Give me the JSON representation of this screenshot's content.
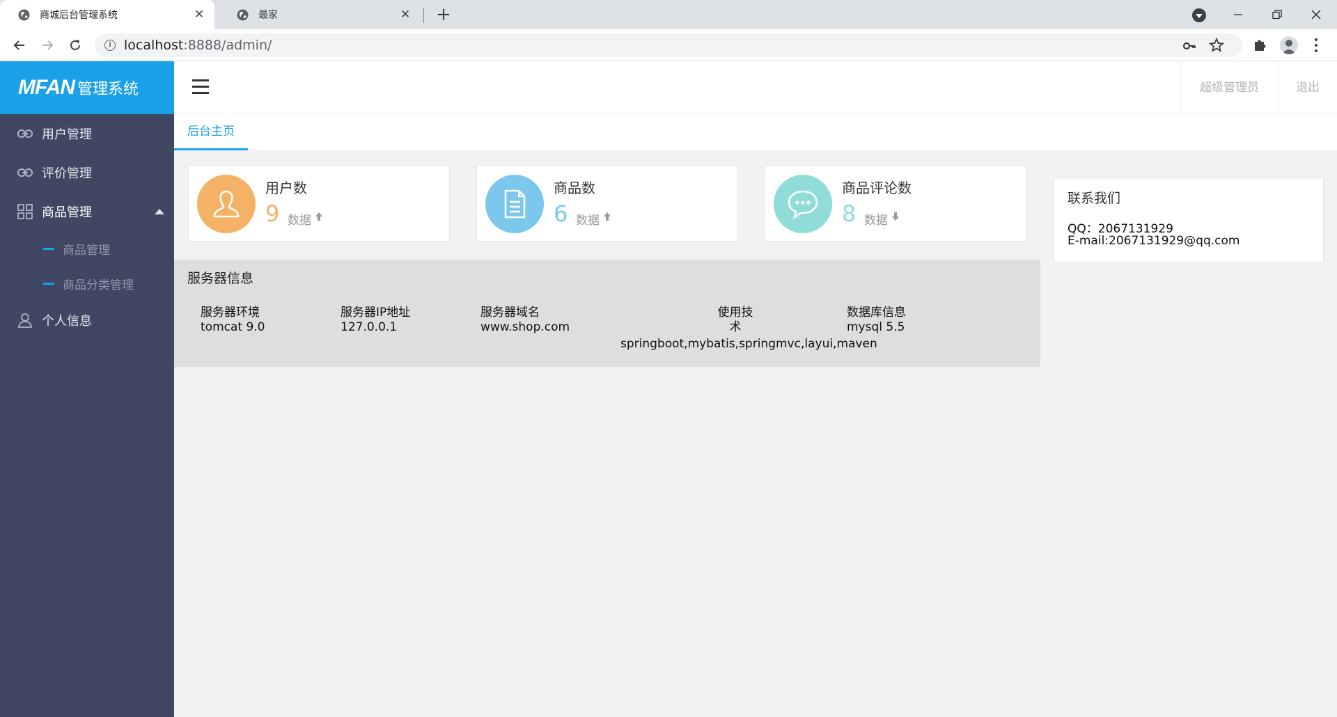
{
  "browser": {
    "tabs": [
      {
        "title": "商城后台管理系统",
        "close": "✕"
      },
      {
        "title": "最家",
        "close": "✕"
      }
    ],
    "new_tab": "+",
    "url_host": "localhost",
    "url_path": ":8888/admin/",
    "info_glyph": "i"
  },
  "app": {
    "logo": {
      "brand": "MFAN",
      "suffix": "管理系统"
    },
    "sidebar": {
      "items": [
        {
          "label": "用户管理",
          "icon": "link-icon"
        },
        {
          "label": "评价管理",
          "icon": "link-icon"
        },
        {
          "label": "商品管理",
          "icon": "grid-icon",
          "expanded": true,
          "children": [
            {
              "label": "商品管理"
            },
            {
              "label": "商品分类管理"
            }
          ]
        },
        {
          "label": "个人信息",
          "icon": "user-icon"
        }
      ]
    },
    "header": {
      "user": "超级管理员",
      "logout": "退出"
    },
    "tabs": {
      "home": "后台主页"
    },
    "stats": [
      {
        "title": "用户数",
        "value": "9",
        "unit": "数据",
        "trend": "up",
        "color": "#f5b266",
        "num_color": "#f5b266",
        "icon": "user-icon"
      },
      {
        "title": "商品数",
        "value": "6",
        "unit": "数据",
        "trend": "up",
        "color": "#7cc7ec",
        "num_color": "#7cc7ec",
        "icon": "document-icon"
      },
      {
        "title": "商品评论数",
        "value": "8",
        "unit": "数据",
        "trend": "down",
        "color": "#8fdcd8",
        "num_color": "#8fdcd8",
        "icon": "chat-icon"
      }
    ],
    "server": {
      "title": "服务器信息",
      "columns": [
        {
          "label": "服务器环境",
          "value": "tomcat 9.0"
        },
        {
          "label": "服务器IP地址",
          "value": "127.0.0.1"
        },
        {
          "label": "服务器域名",
          "value": "www.shop.com"
        },
        {
          "label_line1": "使用技",
          "label_line2": "术",
          "value": "springboot,mybatis,springmvc,layui,maven"
        },
        {
          "label": "数据库信息",
          "value": "mysql 5.5"
        }
      ]
    },
    "contact": {
      "title": "联系我们",
      "qq": "QQ：2067131929",
      "email": "E-mail:2067131929@qq.com"
    }
  }
}
